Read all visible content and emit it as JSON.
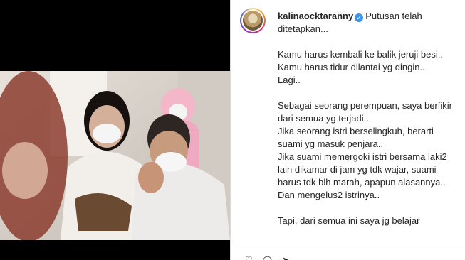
{
  "post": {
    "username": "kalinaocktaranny",
    "verified": true,
    "caption_first": "Putusan telah ditetapkan...",
    "paragraphs": [
      [
        "Kamu harus kembali ke balik jeruji besi..",
        "Kamu harus tidur dilantai yg dingin..",
        "Lagi.."
      ],
      [
        "Sebagai seorang perempuan, saya berfikir dari semua yg terjadi..",
        "Jika seorang istri berselingkuh, berarti suami yg masuk penjara..",
        "Jika suami memergoki istri bersama laki2 lain dikamar di jam yg tdk wajar, suami harus tdk blh marah, apapun alasannya..",
        "Dan mengelus2 istrinya.."
      ],
      [
        "Tapi, dari semua ini saya jg belajar"
      ]
    ]
  },
  "icons": {
    "verified": "verified-badge-icon",
    "like": "heart-icon",
    "comment": "comment-icon",
    "share": "share-icon"
  },
  "colors": {
    "verified_blue": "#3897f0",
    "text": "#262626"
  }
}
